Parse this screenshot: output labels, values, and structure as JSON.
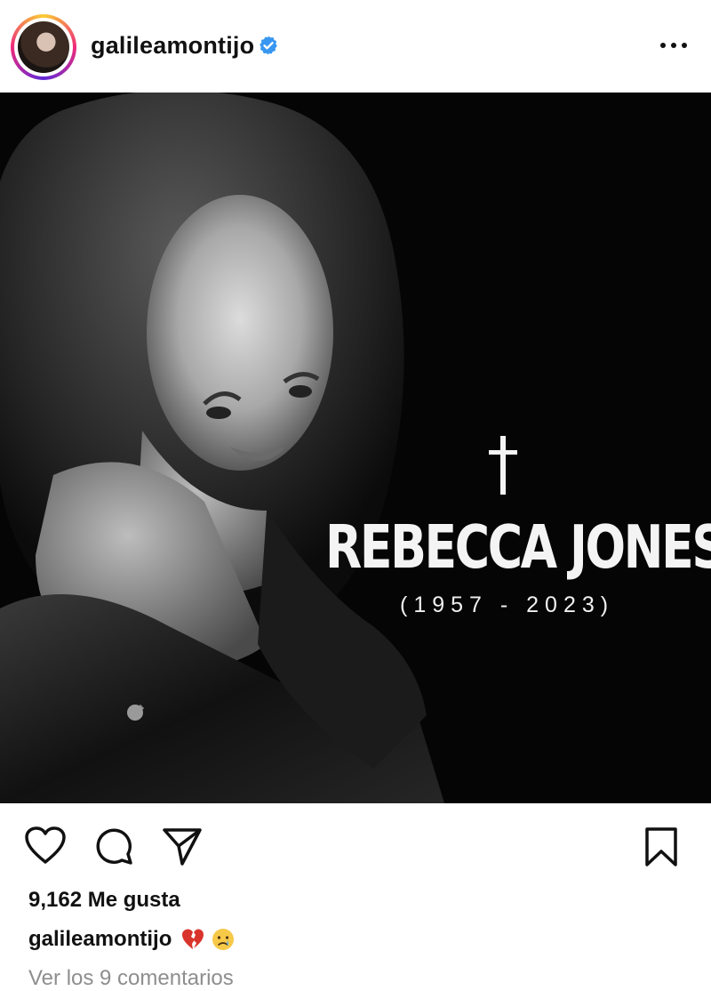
{
  "post": {
    "username": "galileamontijo",
    "verified": true,
    "more_icon": "more-horizontal-icon",
    "image": {
      "headline": "REBECCA JONES",
      "years": "(1957 - 2023)",
      "symbol": "†"
    },
    "likes_text": "9,162 Me gusta",
    "caption_user": "galileamontijo",
    "caption_emojis": [
      "broken-heart",
      "crying-face"
    ],
    "view_comments": "Ver los 9 comentarios"
  },
  "icons": [
    "heart-icon",
    "comment-icon",
    "share-icon",
    "bookmark-icon"
  ],
  "colors": {
    "verified": "#3897f0",
    "muted": "#8e8e8e",
    "image_bg": "#050505"
  }
}
